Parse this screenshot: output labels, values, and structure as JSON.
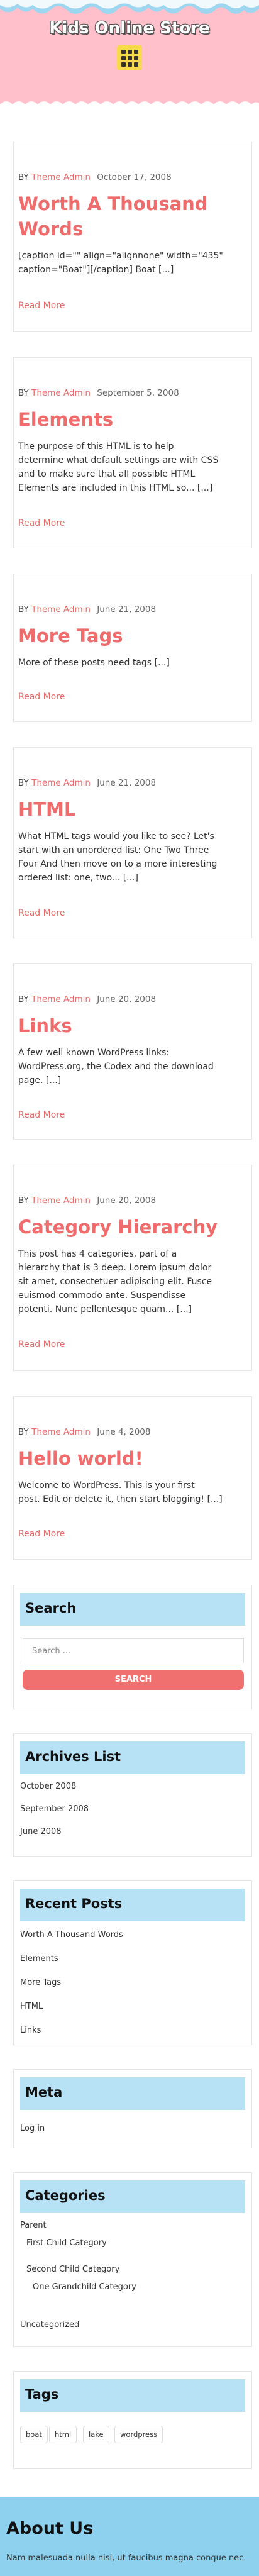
{
  "site": {
    "title": "Kids Online Store",
    "menu_icon": "grid-menu-icon",
    "colors": {
      "header_bg": "#ffc0cb",
      "accent": "#f06b6b",
      "widget_title_bg": "#b7e1f5",
      "footer_bg": "#8ed1ee",
      "menu_button": "#f7d94c"
    }
  },
  "posts": [
    {
      "by": "BY",
      "author": "Theme Admin",
      "date": "October 17, 2008",
      "title_lines": [
        "Worth A Thousand",
        "Words"
      ],
      "excerpt_lines": [
        "[caption id=\"\" align=\"alignnone\" width=\"435\"",
        "caption=\"Boat\"][/caption] Boat [...]"
      ],
      "read_more": "Read More"
    },
    {
      "by": "BY",
      "author": "Theme Admin",
      "date": "September 5, 2008",
      "title_lines": [
        "Elements"
      ],
      "excerpt_lines": [
        "The purpose of this HTML is to help",
        "determine what default settings are with CSS",
        "and to make sure that all possible HTML",
        "Elements are included in this HTML so... [...]"
      ],
      "read_more": "Read More"
    },
    {
      "by": "BY",
      "author": "Theme Admin",
      "date": "June 21, 2008",
      "title_lines": [
        "More Tags"
      ],
      "excerpt_lines": [
        "More of these posts need tags [...]"
      ],
      "read_more": "Read More"
    },
    {
      "by": "BY",
      "author": "Theme Admin",
      "date": "June 21, 2008",
      "title_lines": [
        "HTML"
      ],
      "excerpt_lines": [
        "What HTML tags would you like to see? Let's",
        "start with an unordered list: One Two Three",
        "Four And then move on to a more interesting",
        "ordered list: one, two... [...]"
      ],
      "read_more": "Read More"
    },
    {
      "by": "BY",
      "author": "Theme Admin",
      "date": "June 20, 2008",
      "title_lines": [
        "Links"
      ],
      "excerpt_lines": [
        "A few well known WordPress links:",
        "WordPress.org, the Codex and the download",
        "page. [...]"
      ],
      "read_more": "Read More"
    },
    {
      "by": "BY",
      "author": "Theme Admin",
      "date": "June 20, 2008",
      "title_lines": [
        "Category Hierarchy"
      ],
      "excerpt_lines": [
        "This post has 4 categories, part of a",
        "hierarchy that is 3 deep. Lorem ipsum dolor",
        "sit amet, consectetuer adipiscing elit. Fusce",
        "euismod commodo ante. Suspendisse",
        "potenti. Nunc pellentesque quam... [...]"
      ],
      "read_more": "Read More"
    },
    {
      "by": "BY",
      "author": "Theme Admin",
      "date": "June 4, 2008",
      "title_lines": [
        "Hello world!"
      ],
      "excerpt_lines": [
        "Welcome to WordPress. This is your first",
        "post. Edit or delete it, then start blogging! [...]"
      ],
      "read_more": "Read More"
    }
  ],
  "search": {
    "title": "Search",
    "placeholder": "Search ...",
    "button": "SEARCH"
  },
  "archives": {
    "title": "Archives List",
    "items": [
      "October 2008",
      "September 2008",
      "June 2008"
    ]
  },
  "recent_posts": {
    "title": "Recent Posts",
    "items": [
      "Worth A Thousand Words",
      "Elements",
      "More Tags",
      "HTML",
      "Links"
    ]
  },
  "meta": {
    "title": "Meta",
    "items": [
      "Log in"
    ]
  },
  "categories": {
    "title": "Categories",
    "items": [
      "Parent",
      "First Child Category",
      "Second Child Category",
      "One Grandchild Category",
      "Uncategorized"
    ]
  },
  "tags": {
    "title": "Tags",
    "items": [
      "boat",
      "html",
      "lake",
      "wordpress"
    ]
  },
  "footer": {
    "title": "About Us",
    "text": "Nam malesuada nulla nisi, ut faucibus magna congue nec."
  }
}
